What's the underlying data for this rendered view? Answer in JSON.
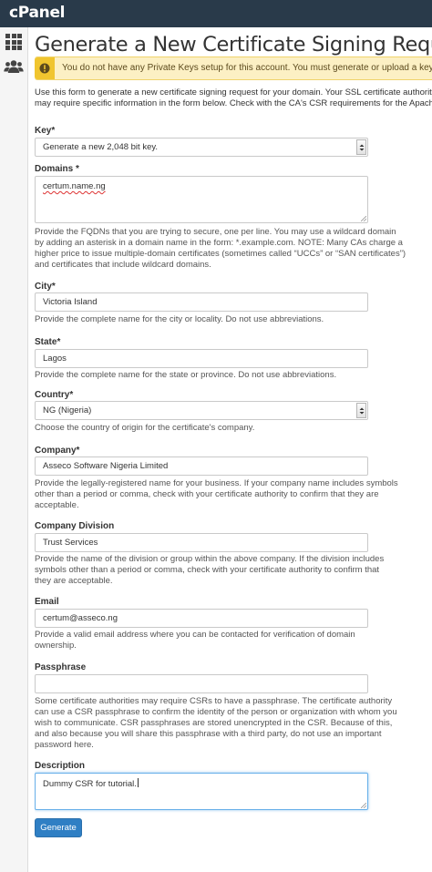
{
  "app": {
    "logo": "cPanel"
  },
  "sidebar": {
    "items": [
      {
        "name": "home",
        "icon": "grid-icon"
      },
      {
        "name": "users",
        "icon": "users-icon"
      }
    ]
  },
  "page": {
    "title": "Generate a New Certificate Signing Request (CSR)",
    "alert": "You do not have any Private Keys setup for this account. You must generate or upload a key before you can",
    "intro": [
      "Use this form to generate a new certificate signing request for your domain. Your SSL certificate authority (CA) will",
      "may require specific information in the form below. Check with the CA's CSR requirements for the Apache web serv"
    ]
  },
  "form": {
    "key": {
      "label": "Key*",
      "value": "Generate a new 2,048 bit key."
    },
    "domains": {
      "label": "Domains *",
      "value": "certum.name.ng",
      "help": [
        "Provide the FQDNs that you are trying to secure, one per line. You may use a wildcard domain",
        "by adding an asterisk in a domain name in the form: *.example.com. NOTE: Many CAs charge a",
        "higher price to issue multiple-domain certificates (sometimes called “UCCs” or “SAN certificates”)",
        "and certificates that include wildcard domains."
      ]
    },
    "city": {
      "label": "City*",
      "value": "Victoria Island",
      "help": "Provide the complete name for the city or locality. Do not use abbreviations."
    },
    "state": {
      "label": "State*",
      "value": "Lagos",
      "help": "Provide the complete name for the state or province. Do not use abbreviations."
    },
    "country": {
      "label": "Country*",
      "value": "NG (Nigeria)",
      "help": "Choose the country of origin for the certificate's company."
    },
    "company": {
      "label": "Company*",
      "value": "Asseco Software Nigeria Limited",
      "help": [
        "Provide the legally-registered name for your business. If your company name includes symbols",
        "other than a period or comma, check with your certificate authority to confirm that they are",
        "acceptable."
      ]
    },
    "division": {
      "label": "Company Division",
      "value": "Trust Services",
      "help": [
        "Provide the name of the division or group within the above company. If the division includes",
        "symbols other than a period or comma, check with your certificate authority to confirm that",
        "they are acceptable."
      ]
    },
    "email": {
      "label": "Email",
      "value": "certum@asseco.ng",
      "help": [
        "Provide a valid email address where you can be contacted for verification of domain",
        "ownership."
      ]
    },
    "passphrase": {
      "label": "Passphrase",
      "value": "",
      "help": [
        "Some certificate authorities may require CSRs to have a passphrase. The certificate authority",
        "can use a CSR passphrase to confirm the identity of the person or organization with whom you",
        "wish to communicate. CSR passphrases are stored unencrypted in the CSR. Because of this,",
        "and also because you will share this passphrase with a third party, do not use an important",
        "password here."
      ]
    },
    "description": {
      "label": "Description",
      "value": "Dummy CSR for tutorial."
    },
    "submit": "Generate"
  },
  "colors": {
    "topbar": "#293a4a",
    "alert_bg": "#fcf0c4",
    "alert_icon": "#f0c52f",
    "button": "#2f7fc4",
    "focus": "#66afe9"
  }
}
